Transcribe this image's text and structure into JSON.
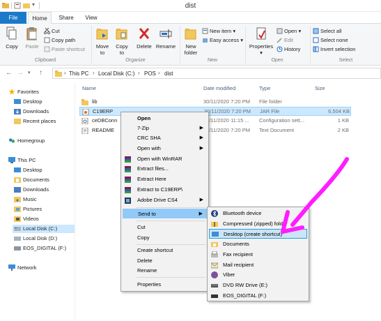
{
  "window": {
    "title": "dist"
  },
  "tabs": [
    "File",
    "Home",
    "Share",
    "View"
  ],
  "ribbon": {
    "clipboard": {
      "copy": "Copy",
      "paste": "Paste",
      "cut": "Cut",
      "copy_path": "Copy path",
      "paste_shortcut": "Paste shortcut",
      "label": "Clipboard"
    },
    "organize": {
      "move_to": [
        "Move",
        "to"
      ],
      "copy_to": [
        "Copy",
        "to"
      ],
      "delete": "Delete",
      "rename": "Rename",
      "label": "Organize"
    },
    "new": {
      "new_folder": [
        "New",
        "folder"
      ],
      "new_item": "New item",
      "easy_access": "Easy access",
      "label": "New"
    },
    "open": {
      "properties": "Properties",
      "open": "Open",
      "edit": "Edit",
      "history": "History",
      "label": "Open"
    },
    "select": {
      "select_all": "Select all",
      "select_none": "Select none",
      "invert_selection": "Invert selection",
      "label": "Select"
    }
  },
  "address": {
    "crumbs": [
      "This PC",
      "Local Disk (C:)",
      "POS",
      "dist"
    ]
  },
  "nav": {
    "favorites": "Favorites",
    "favorites_items": [
      "Desktop",
      "Downloads",
      "Recent places"
    ],
    "homegroup": "Homegroup",
    "this_pc": "This PC",
    "this_pc_items": [
      "Desktop",
      "Documents",
      "Downloads",
      "Music",
      "Pictures",
      "Videos",
      "Local Disk (C:)",
      "Local Disk (D:)",
      "EOS_DIGITAL (F:)"
    ],
    "network": "Network"
  },
  "columns": {
    "name": "Name",
    "date": "Date modified",
    "type": "Type",
    "size": "Size"
  },
  "files": [
    {
      "name": "lib",
      "date": "30/11/2020 7:20 PM",
      "type": "File folder",
      "size": ""
    },
    {
      "name": "C19ERP",
      "date": "30/11/2020 7:20 PM",
      "type": "JAR File",
      "size": "6,504 KB"
    },
    {
      "name": "ceDBConn",
      "date": "30/11/2020 11:15 ...",
      "type": "Configuration sett...",
      "size": "1 KB"
    },
    {
      "name": "README",
      "date": "30/11/2020 7:20 PM",
      "type": "Text Document",
      "size": "2 KB"
    }
  ],
  "context_menu": {
    "items": [
      {
        "label": "Open",
        "bold": true
      },
      {
        "label": "7-Zip",
        "arrow": true
      },
      {
        "label": "CRC SHA",
        "arrow": true
      },
      {
        "label": "Open with",
        "arrow": true
      },
      {
        "label": "Open with WinRAR",
        "icon": "winrar"
      },
      {
        "label": "Extract files...",
        "icon": "winrar"
      },
      {
        "label": "Extract Here",
        "icon": "winrar"
      },
      {
        "label": "Extract to C19ERP\\",
        "icon": "winrar"
      },
      {
        "label": "Adobe Drive CS4",
        "arrow": true,
        "icon": "adobe"
      },
      {
        "label": "Send to",
        "arrow": true
      },
      {
        "label": "Cut"
      },
      {
        "label": "Copy"
      },
      {
        "label": "Create shortcut"
      },
      {
        "label": "Delete"
      },
      {
        "label": "Rename"
      },
      {
        "label": "Properties"
      }
    ]
  },
  "send_to": {
    "items": [
      "Bluetooth device",
      "Compressed (zipped) folder",
      "Desktop (create shortcut)",
      "Documents",
      "Fax recipient",
      "Mail recipient",
      "Viber",
      "DVD RW Drive (E:)",
      "EOS_DIGITAL (F:)"
    ]
  },
  "colors": {
    "accent": "#1979ca",
    "annotation": "#ff1dff"
  }
}
